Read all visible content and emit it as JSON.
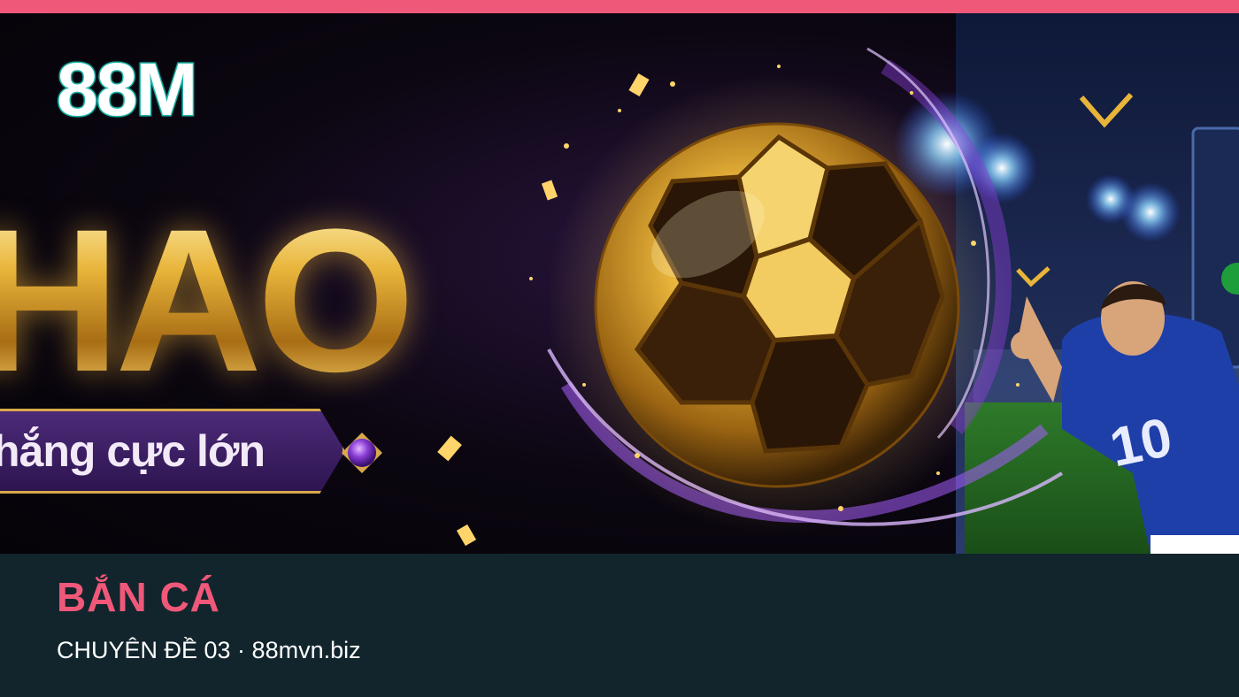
{
  "brand": {
    "logo_text": "88M"
  },
  "hero": {
    "headline": "HAO",
    "tagline": "hắng cực lớn",
    "player_number": "10"
  },
  "footer": {
    "title": "BẮN CÁ",
    "subtitle": "CHUYÊN ĐỀ 03 · 88mvn.biz"
  },
  "colors": {
    "accent": "#f0587a",
    "background": "#12252d",
    "gold": "#e8b43a",
    "purple": "#4c2a78",
    "teal": "#1fb5a8"
  },
  "icons": [
    "soccer-ball-icon",
    "gem-icon",
    "checkmark-icon"
  ]
}
